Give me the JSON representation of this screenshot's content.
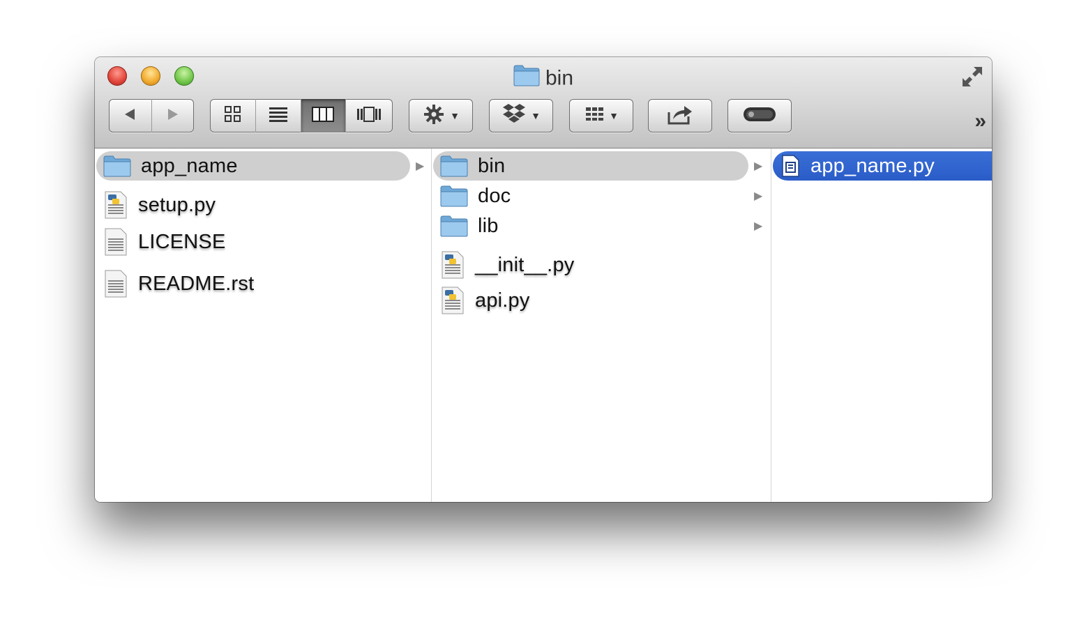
{
  "window": {
    "title": "bin"
  },
  "toolbar": {
    "back_icon": "back-arrow-icon",
    "forward_icon": "forward-arrow-icon",
    "views": [
      "icon-view",
      "list-view",
      "column-view",
      "coverflow-view"
    ],
    "active_view": "column-view",
    "action_icon": "gear-icon",
    "dropbox_icon": "dropbox-icon",
    "arrange_icon": "arrange-grid-icon",
    "share_icon": "share-icon",
    "toggle_icon": "toggle-icon",
    "overflow": "»"
  },
  "columns": [
    {
      "items": [
        {
          "name": "app_name",
          "kind": "folder",
          "selected": "inactive",
          "has_children": true
        },
        {
          "name": "setup.py",
          "kind": "python"
        },
        {
          "name": "LICENSE",
          "kind": "text"
        },
        {
          "name": "README.rst",
          "kind": "text"
        }
      ]
    },
    {
      "items": [
        {
          "name": "bin",
          "kind": "folder",
          "selected": "inactive",
          "has_children": true
        },
        {
          "name": "doc",
          "kind": "folder",
          "has_children": true
        },
        {
          "name": "lib",
          "kind": "folder",
          "has_children": true
        },
        {
          "name": "__init__.py",
          "kind": "python"
        },
        {
          "name": "api.py",
          "kind": "python"
        }
      ]
    },
    {
      "items": [
        {
          "name": "app_name.py",
          "kind": "document",
          "selected": "active"
        }
      ]
    }
  ],
  "colors": {
    "selection_active": "#2a5cc8",
    "selection_inactive": "#cfcfcf",
    "folder": "#8ec3ea"
  }
}
